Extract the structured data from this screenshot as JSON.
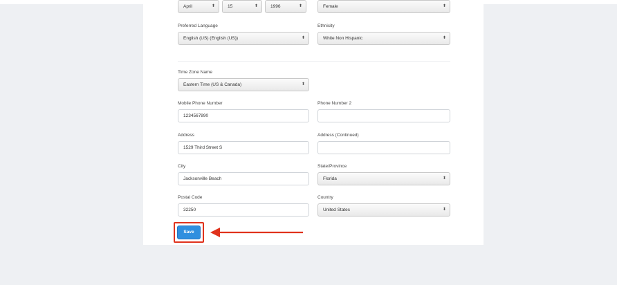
{
  "form": {
    "birth_month": "April",
    "birth_day": "15",
    "birth_year": "1996",
    "gender": "Female",
    "preferred_language": {
      "label": "Preferred Language",
      "value": "English (US) (English (US))"
    },
    "ethnicity": {
      "label": "Ethnicity",
      "value": "White Non Hispanic"
    },
    "time_zone": {
      "label": "Time Zone Name",
      "value": "Eastern Time (US & Canada)"
    },
    "mobile_phone": {
      "label": "Mobile Phone Number",
      "value": "1234567890"
    },
    "phone2": {
      "label": "Phone Number 2",
      "value": ""
    },
    "address": {
      "label": "Address",
      "value": "1529 Third Street S"
    },
    "address2": {
      "label": "Address (Continued)",
      "value": ""
    },
    "city": {
      "label": "City",
      "value": "Jacksonville Beach"
    },
    "state": {
      "label": "State/Province",
      "value": "Florida"
    },
    "postal_code": {
      "label": "Postal Code",
      "value": "32250"
    },
    "country": {
      "label": "Country",
      "value": "United States"
    },
    "save_label": "Save"
  },
  "icons": {
    "select_caret": "updown-caret-icon",
    "pointer": "arrow-left-icon"
  },
  "colors": {
    "highlight": "#e0321c",
    "save_button": "#2f8fdf",
    "background": "#eef0f3"
  }
}
